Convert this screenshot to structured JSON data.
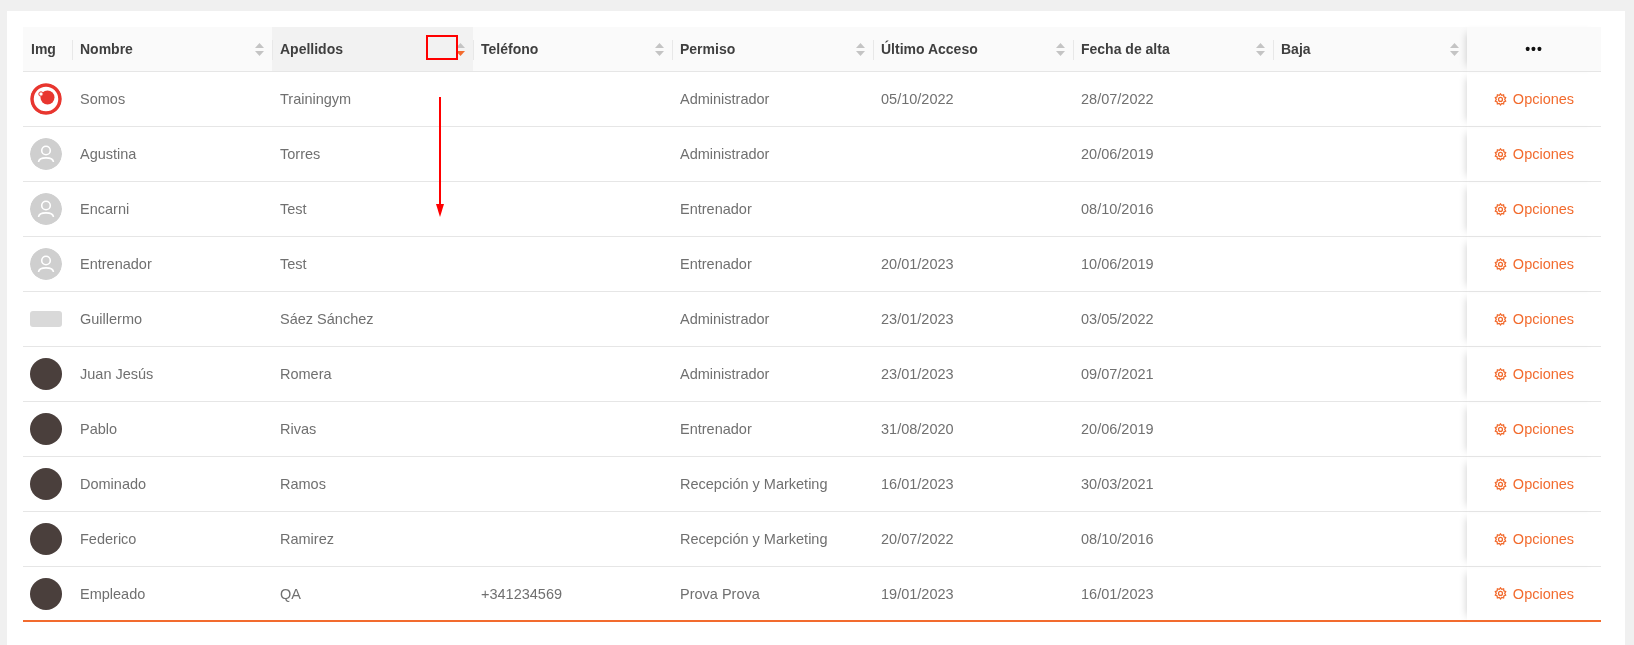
{
  "table": {
    "columns": [
      {
        "label": "Img",
        "kind": "plain"
      },
      {
        "label": "Nombre",
        "kind": "sortable",
        "sorted": false
      },
      {
        "label": "Apellidos",
        "kind": "sortable",
        "sorted": true
      },
      {
        "label": "Teléfono",
        "kind": "sortable",
        "sorted": false
      },
      {
        "label": "Permiso",
        "kind": "sortable",
        "sorted": false
      },
      {
        "label": "Último Acceso",
        "kind": "sortable",
        "sorted": false
      },
      {
        "label": "Fecha de alta",
        "kind": "sortable",
        "sorted": false
      },
      {
        "label": "Baja",
        "kind": "sortable",
        "sorted": false
      },
      {
        "label": "•••",
        "kind": "menu"
      }
    ],
    "rows": [
      {
        "avatar": {
          "kind": "logo"
        },
        "cells": [
          "",
          "Somos",
          "Trainingym",
          "",
          "Administrador",
          "05/10/2022",
          "28/07/2022",
          ""
        ],
        "action": "Opciones"
      },
      {
        "avatar": {
          "kind": "default"
        },
        "cells": [
          "",
          "Agustina",
          "Torres",
          "",
          "Administrador",
          "",
          "20/06/2019",
          ""
        ],
        "action": "Opciones"
      },
      {
        "avatar": {
          "kind": "default"
        },
        "cells": [
          "",
          "Encarni",
          "Test",
          "",
          "Entrenador",
          "",
          "08/10/2016",
          ""
        ],
        "action": "Opciones"
      },
      {
        "avatar": {
          "kind": "default"
        },
        "cells": [
          "",
          "Entrenador",
          "Test",
          "",
          "Entrenador",
          "20/01/2023",
          "10/06/2019",
          ""
        ],
        "action": "Opciones"
      },
      {
        "avatar": {
          "kind": "image"
        },
        "cells": [
          "",
          "Guillermo",
          "Sáez Sánchez",
          "",
          "Administrador",
          "23/01/2023",
          "03/05/2022",
          ""
        ],
        "action": "Opciones"
      },
      {
        "avatar": {
          "kind": "photo"
        },
        "cells": [
          "",
          "Juan Jesús",
          "Romera",
          "",
          "Administrador",
          "23/01/2023",
          "09/07/2021",
          ""
        ],
        "action": "Opciones"
      },
      {
        "avatar": {
          "kind": "photo"
        },
        "cells": [
          "",
          "Pablo",
          "Rivas",
          "",
          "Entrenador",
          "31/08/2020",
          "20/06/2019",
          ""
        ],
        "action": "Opciones"
      },
      {
        "avatar": {
          "kind": "photo"
        },
        "cells": [
          "",
          "Dominado",
          "Ramos",
          "",
          "Recepción y Marketing",
          "16/01/2023",
          "30/03/2021",
          ""
        ],
        "action": "Opciones"
      },
      {
        "avatar": {
          "kind": "photo"
        },
        "cells": [
          "",
          "Federico",
          "Ramirez",
          "",
          "Recepción y Marketing",
          "20/07/2022",
          "08/10/2016",
          ""
        ],
        "action": "Opciones"
      },
      {
        "avatar": {
          "kind": "photo"
        },
        "cells": [
          "",
          "Empleado",
          "QA",
          "+341234569",
          "Prova Prova",
          "19/01/2023",
          "16/01/2023",
          ""
        ],
        "action": "Opciones"
      }
    ]
  }
}
